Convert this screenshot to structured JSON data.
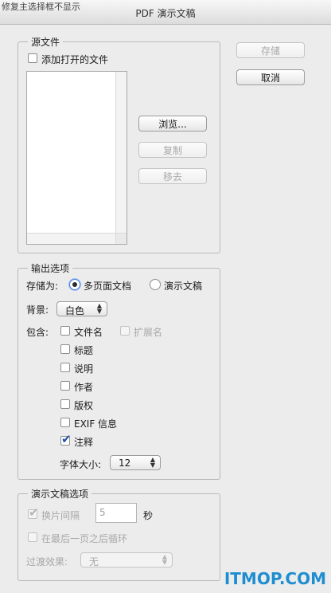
{
  "corner_text": "修复主选择框不显示",
  "window": {
    "title": "PDF 演示文稿"
  },
  "source": {
    "legend": "源文件",
    "add_open_files_label": "添加打开的文件",
    "add_open_files_checked": false,
    "browse_label": "浏览...",
    "copy_label": "复制",
    "remove_label": "移去"
  },
  "actions": {
    "save_label": "存储",
    "cancel_label": "取消"
  },
  "output": {
    "legend": "输出选项",
    "save_as_label": "存储为:",
    "multi_page_label": "多页面文档",
    "presentation_label": "演示文稿",
    "selected_mode": "multi_page",
    "background_label": "背景:",
    "background_value": "白色",
    "include_label": "包含:",
    "include_items": [
      {
        "label": "文件名",
        "checked": false,
        "enabled": true
      },
      {
        "label": "标题",
        "checked": false,
        "enabled": true
      },
      {
        "label": "说明",
        "checked": false,
        "enabled": true
      },
      {
        "label": "作者",
        "checked": false,
        "enabled": true
      },
      {
        "label": "版权",
        "checked": false,
        "enabled": true
      },
      {
        "label": "EXIF 信息",
        "checked": false,
        "enabled": true
      },
      {
        "label": "注释",
        "checked": true,
        "enabled": true
      }
    ],
    "extension_label": "扩展名",
    "font_size_label": "字体大小:",
    "font_size_value": "12"
  },
  "presentation": {
    "legend": "演示文稿选项",
    "advance_label": "换片间隔",
    "advance_checked": true,
    "advance_value": "5",
    "seconds_label": "秒",
    "loop_label": "在最后一页之后循环",
    "loop_checked": false,
    "transition_label": "过渡效果:",
    "transition_value": "无"
  },
  "watermark": "ITMOP.COM",
  "colors": {
    "accent": "#1e4fa8",
    "watermark": "#1f8ed0",
    "window_bg": "#ececec"
  }
}
